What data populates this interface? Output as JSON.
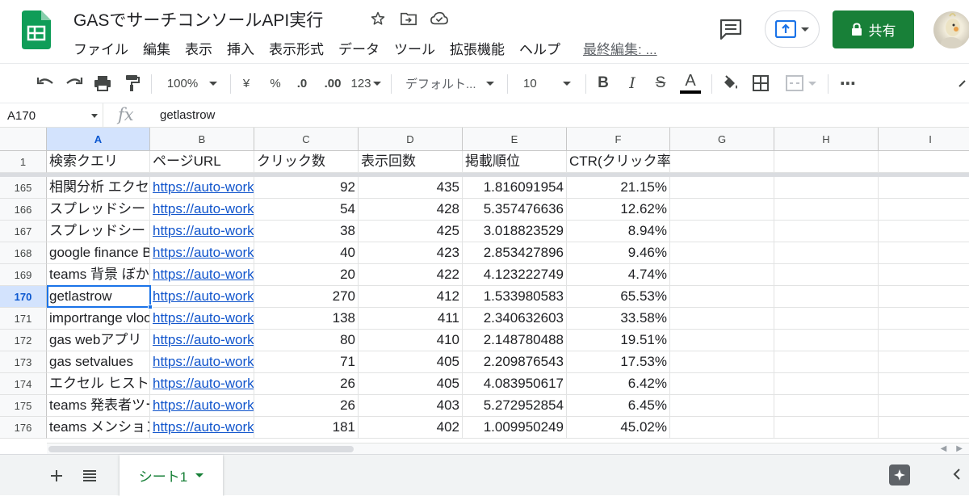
{
  "app": {
    "title": "GASでサーチコンソールAPI実行",
    "last_edit": "最終編集: ...",
    "share_label": "共有"
  },
  "menu": [
    "ファイル",
    "編集",
    "表示",
    "挿入",
    "表示形式",
    "データ",
    "ツール",
    "拡張機能",
    "ヘルプ"
  ],
  "toolbar": {
    "zoom": "100%",
    "currency": "¥",
    "percent": "%",
    "decrease_decimal": ".0",
    "increase_decimal": ".00",
    "more_formats": "123",
    "font": "デフォルト...",
    "font_size": "10",
    "bold": "B",
    "italic": "I",
    "strike": "S",
    "text_color": "A",
    "more": "⋯"
  },
  "formula_bar": {
    "cell_ref": "A170",
    "fx": "fx",
    "value": "getlastrow"
  },
  "columns": [
    "A",
    "B",
    "C",
    "D",
    "E",
    "F",
    "G",
    "H",
    "I"
  ],
  "header_row": {
    "row_number": "1",
    "cells": [
      "検索クエリ",
      "ページURL",
      "クリック数",
      "表示回数",
      "掲載順位",
      "CTR(クリック率)"
    ]
  },
  "rows": [
    {
      "n": "165",
      "query": "相関分析 エクセル",
      "url": "https://auto-worker",
      "clicks": "92",
      "impressions": "435",
      "position": "1.816091954",
      "ctr": "21.15%"
    },
    {
      "n": "166",
      "query": "スプレッドシート",
      "url": "https://auto-worker",
      "clicks": "54",
      "impressions": "428",
      "position": "5.357476636",
      "ctr": "12.62%"
    },
    {
      "n": "167",
      "query": "スプレッドシート",
      "url": "https://auto-worker",
      "clicks": "38",
      "impressions": "425",
      "position": "3.018823529",
      "ctr": "8.94%"
    },
    {
      "n": "168",
      "query": "google finance B",
      "url": "https://auto-worker",
      "clicks": "40",
      "impressions": "423",
      "position": "2.853427896",
      "ctr": "9.46%"
    },
    {
      "n": "169",
      "query": "teams 背景 ぼかし",
      "url": "https://auto-worker",
      "clicks": "20",
      "impressions": "422",
      "position": "4.123222749",
      "ctr": "4.74%"
    },
    {
      "n": "170",
      "query": "getlastrow",
      "url": "https://auto-worker",
      "clicks": "270",
      "impressions": "412",
      "position": "1.533980583",
      "ctr": "65.53%"
    },
    {
      "n": "171",
      "query": "importrange vlookup",
      "url": "https://auto-worker",
      "clicks": "138",
      "impressions": "411",
      "position": "2.340632603",
      "ctr": "33.58%"
    },
    {
      "n": "172",
      "query": "gas webアプリ",
      "url": "https://auto-worker",
      "clicks": "80",
      "impressions": "410",
      "position": "2.148780488",
      "ctr": "19.51%"
    },
    {
      "n": "173",
      "query": "gas setvalues",
      "url": "https://auto-worker",
      "clicks": "71",
      "impressions": "405",
      "position": "2.209876543",
      "ctr": "17.53%"
    },
    {
      "n": "174",
      "query": "エクセル ヒストグラム",
      "url": "https://auto-worker",
      "clicks": "26",
      "impressions": "405",
      "position": "4.083950617",
      "ctr": "6.42%"
    },
    {
      "n": "175",
      "query": "teams 発表者ツール",
      "url": "https://auto-worker",
      "clicks": "26",
      "impressions": "403",
      "position": "5.272952854",
      "ctr": "6.45%"
    },
    {
      "n": "176",
      "query": "teams メンション",
      "url": "https://auto-worker",
      "clicks": "181",
      "impressions": "402",
      "position": "1.009950249",
      "ctr": "45.02%"
    }
  ],
  "sheet": {
    "tab_label": "シート1"
  },
  "colors": {
    "brand_green": "#188038",
    "selection_blue": "#1a73e8",
    "link_blue": "#1155cc"
  }
}
